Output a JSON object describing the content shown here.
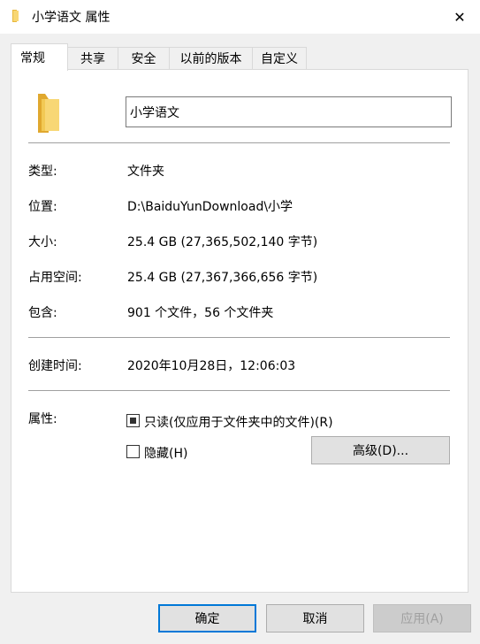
{
  "window": {
    "title": "小学语文 属性",
    "icon": "folder-icon",
    "close_glyph": "✕"
  },
  "tabs": [
    {
      "label": "常规",
      "active": true
    },
    {
      "label": "共享"
    },
    {
      "label": "安全"
    },
    {
      "label": "以前的版本"
    },
    {
      "label": "自定义"
    }
  ],
  "general": {
    "name_value": "小学语文",
    "rows": {
      "type": {
        "label": "类型:",
        "value": "文件夹"
      },
      "location": {
        "label": "位置:",
        "value": "D:\\BaiduYunDownload\\小学"
      },
      "size": {
        "label": "大小:",
        "value": "25.4 GB (27,365,502,140 字节)"
      },
      "size_on_disk": {
        "label": "占用空间:",
        "value": "25.4 GB (27,367,366,656 字节)"
      },
      "contains": {
        "label": "包含:",
        "value": "901 个文件，56 个文件夹"
      },
      "created": {
        "label": "创建时间:",
        "value": "2020年10月28日，12:06:03"
      }
    },
    "attributes": {
      "label": "属性:",
      "readonly_label": "只读(仅应用于文件夹中的文件)(R)",
      "readonly_state": "indeterminate",
      "hidden_label": "隐藏(H)",
      "hidden_checked": false,
      "advanced_button": "高级(D)..."
    }
  },
  "footer": {
    "ok": "确定",
    "cancel": "取消",
    "apply": "应用(A)"
  },
  "colors": {
    "folder_yellow": "#f8d775",
    "accent": "#0078d7"
  }
}
